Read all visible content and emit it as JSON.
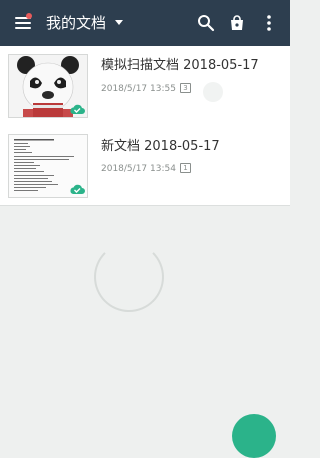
{
  "appbar": {
    "title": "我的文档",
    "icons": [
      "menu-icon",
      "chevron-down-icon",
      "search-icon",
      "bag-icon",
      "more-vert-icon"
    ],
    "colors": {
      "bar": "#2d3e4f",
      "accent": "#2bb38a",
      "notification": "#e85a5a"
    }
  },
  "documents": [
    {
      "title": "模拟扫描文档 2018-05-17",
      "timestamp": "2018/5/17 13:55",
      "pages": "3",
      "synced": true
    },
    {
      "title": "新文档 2018-05-17",
      "timestamp": "2018/5/17 13:54",
      "pages": "1",
      "synced": true
    }
  ]
}
